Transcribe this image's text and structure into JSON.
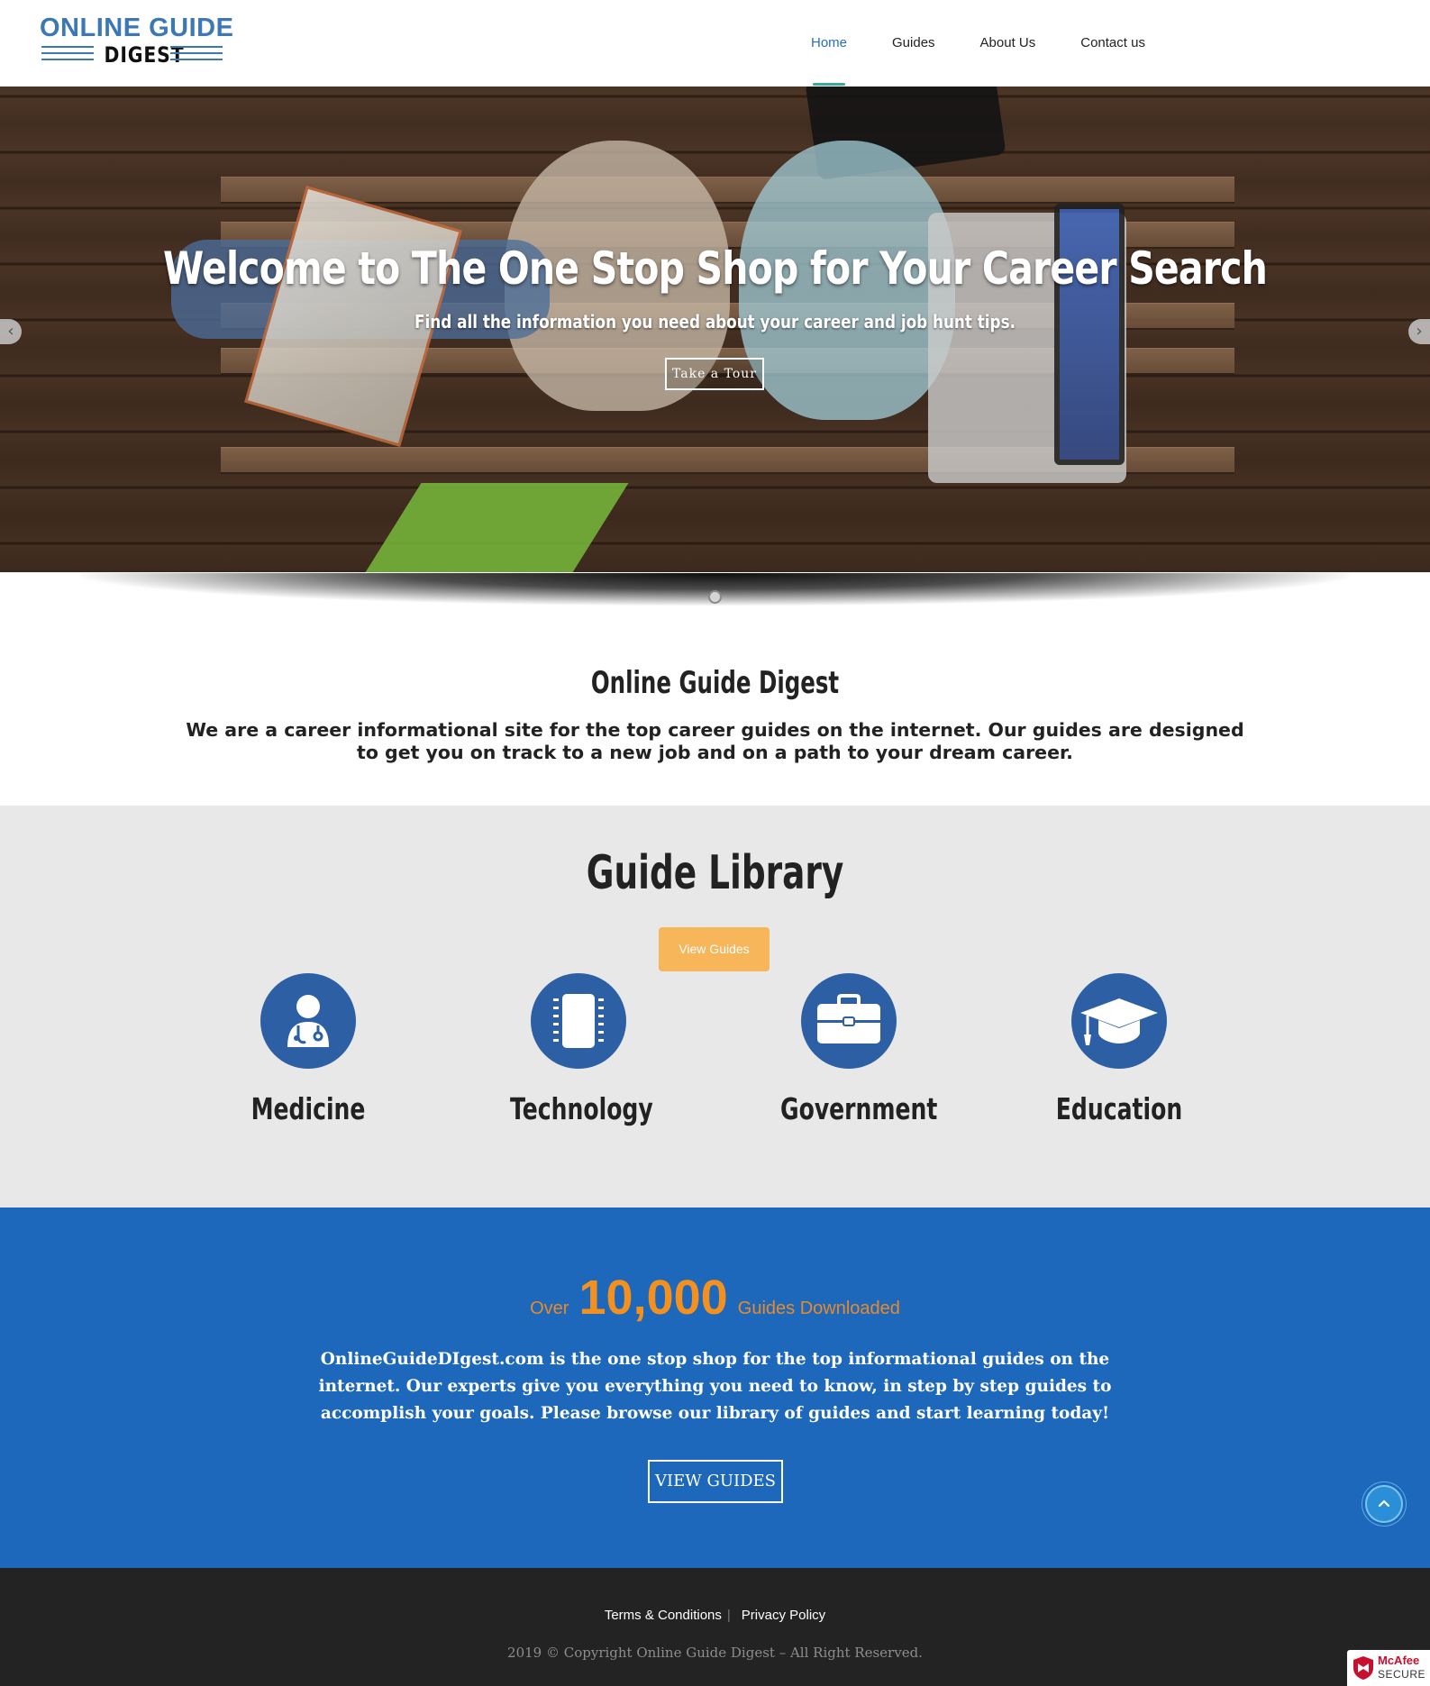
{
  "header": {
    "logo_top": "ONLINE GUIDE",
    "logo_bottom": "DIGEST",
    "nav": [
      {
        "label": "Home",
        "active": true
      },
      {
        "label": "Guides",
        "active": false
      },
      {
        "label": "About Us",
        "active": false
      },
      {
        "label": "Contact us",
        "active": false
      }
    ]
  },
  "hero": {
    "title": "Welcome to The One Stop Shop for Your Career Search",
    "subtitle": "Find all the information you need about your career and job hunt tips.",
    "button_label": "Take a Tour",
    "prev_icon": "chevron-left-icon",
    "next_icon": "chevron-right-icon",
    "prev_glyph": "‹",
    "next_glyph": "›"
  },
  "intro": {
    "title": "Online Guide Digest",
    "text": "We are a career informational site for the top career guides on the internet. Our guides are designed to get you on track to a new job and on a path to your dream career."
  },
  "library": {
    "title": "Guide Library",
    "button_label": "View Guides",
    "categories": [
      {
        "label": "Medicine",
        "icon": "doctor-icon"
      },
      {
        "label": "Technology",
        "icon": "tablet-icon"
      },
      {
        "label": "Government",
        "icon": "briefcase-icon"
      },
      {
        "label": "Education",
        "icon": "graduation-cap-icon"
      }
    ]
  },
  "stats": {
    "prefix": "Over",
    "number": "10,000",
    "suffix": "Guides Downloaded",
    "text": "OnlineGuideDIgest.com is the one stop shop for the top informational guides on the internet. Our experts give you everything you need to know, in step by step guides to accomplish your goals. Please browse our library of guides and start learning today!",
    "button_label": "VIEW GUIDES"
  },
  "footer": {
    "links": [
      "Terms & Conditions",
      "Privacy Policy"
    ],
    "separator": "|",
    "copyright": "2019 © Copyright Online Guide Digest – All Right Reserved."
  },
  "badge": {
    "line1": "McAfee",
    "line2": "SECURE"
  },
  "colors": {
    "brand_blue": "#3c78b4",
    "icon_blue": "#2c5fa3",
    "stats_blue": "#1e68bb",
    "orange": "#f29020",
    "button_orange": "#f7b65a",
    "footer_dark": "#232323"
  }
}
